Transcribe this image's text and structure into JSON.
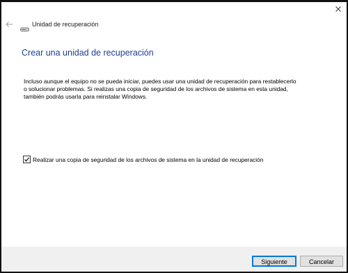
{
  "window": {
    "title": "Unidad de recuperación"
  },
  "icons": {
    "back": "back-arrow-icon",
    "drive": "drive-icon",
    "close": "close-icon"
  },
  "main": {
    "heading": "Crear una unidad de recuperación",
    "description": "Incluso aunque el equipo no se pueda iniciar, puedes usar una unidad de recuperación para restablecerlo o solucionar problemas. Si realizas una copia de seguridad de los archivos de sistema en esta unidad, también podrás usarla para reinstalar Windows.",
    "backup_checkbox": {
      "label": "Realizar una copia de seguridad de los archivos de sistema en la unidad de recuperación",
      "checked": true
    }
  },
  "buttons": {
    "next": "Siguiente",
    "cancel": "Cancelar"
  },
  "colors": {
    "heading": "#1d3f8f",
    "primary_border": "#0078d7",
    "footer_bg": "#f0f0f0"
  }
}
